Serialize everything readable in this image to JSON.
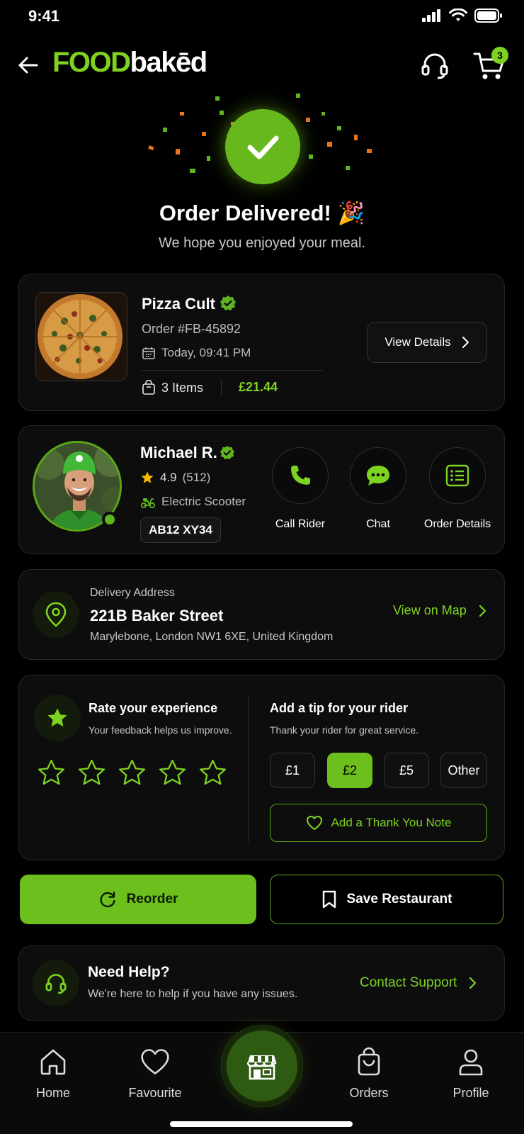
{
  "status_bar": {
    "time": "9:41"
  },
  "header": {
    "logo_part1": "FOOD",
    "logo_part2": "bakēd",
    "cart_count": "3"
  },
  "hero": {
    "title": "Order Delivered! 🎉",
    "subtitle": "We hope you enjoyed your meal."
  },
  "order": {
    "restaurant": "Pizza Cult",
    "order_number": "Order #FB-45892",
    "date": "Today, 09:41 PM",
    "items": "3 Items",
    "price": "£21.44",
    "view_details_label": "View Details"
  },
  "rider": {
    "name": "Michael R.",
    "rating": "4.9",
    "rating_count": "(512)",
    "vehicle": "Electric Scooter",
    "plate": "AB12 XY34",
    "actions": [
      {
        "label": "Call Rider",
        "icon": "phone-icon"
      },
      {
        "label": "Chat",
        "icon": "chat-icon"
      },
      {
        "label": "Order Details",
        "icon": "list-icon"
      }
    ]
  },
  "address": {
    "label": "Delivery Address",
    "line1": "221B Baker Street",
    "line2": "Marylebone, London NW1 6XE, United Kingdom",
    "map_link": "View on Map"
  },
  "rating_section": {
    "title": "Rate your experience",
    "subtitle": "Your feedback helps us improve.",
    "stars": 5,
    "selected_stars": 0
  },
  "tip_section": {
    "title": "Add a tip for your rider",
    "subtitle": "Thank your rider for great service.",
    "options": [
      "£1",
      "£2",
      "£5",
      "Other"
    ],
    "selected": "£2",
    "note_label": "Add a Thank You Note"
  },
  "buttons": {
    "reorder": "Reorder",
    "save_restaurant": "Save Restaurant"
  },
  "help": {
    "title": "Need Help?",
    "subtitle": "We're here to help if you have any issues.",
    "link": "Contact Support"
  },
  "nav": {
    "items": [
      {
        "label": "Home",
        "icon": "home-icon"
      },
      {
        "label": "Favourite",
        "icon": "heart-icon"
      },
      {
        "label": "Orders",
        "icon": "bag-icon"
      },
      {
        "label": "Profile",
        "icon": "profile-icon"
      }
    ],
    "center_icon": "store-icon"
  },
  "colors": {
    "accent": "#7ed321",
    "accent_dark": "#6cbf1c",
    "background": "#000000",
    "card": "#0d0d0d"
  }
}
